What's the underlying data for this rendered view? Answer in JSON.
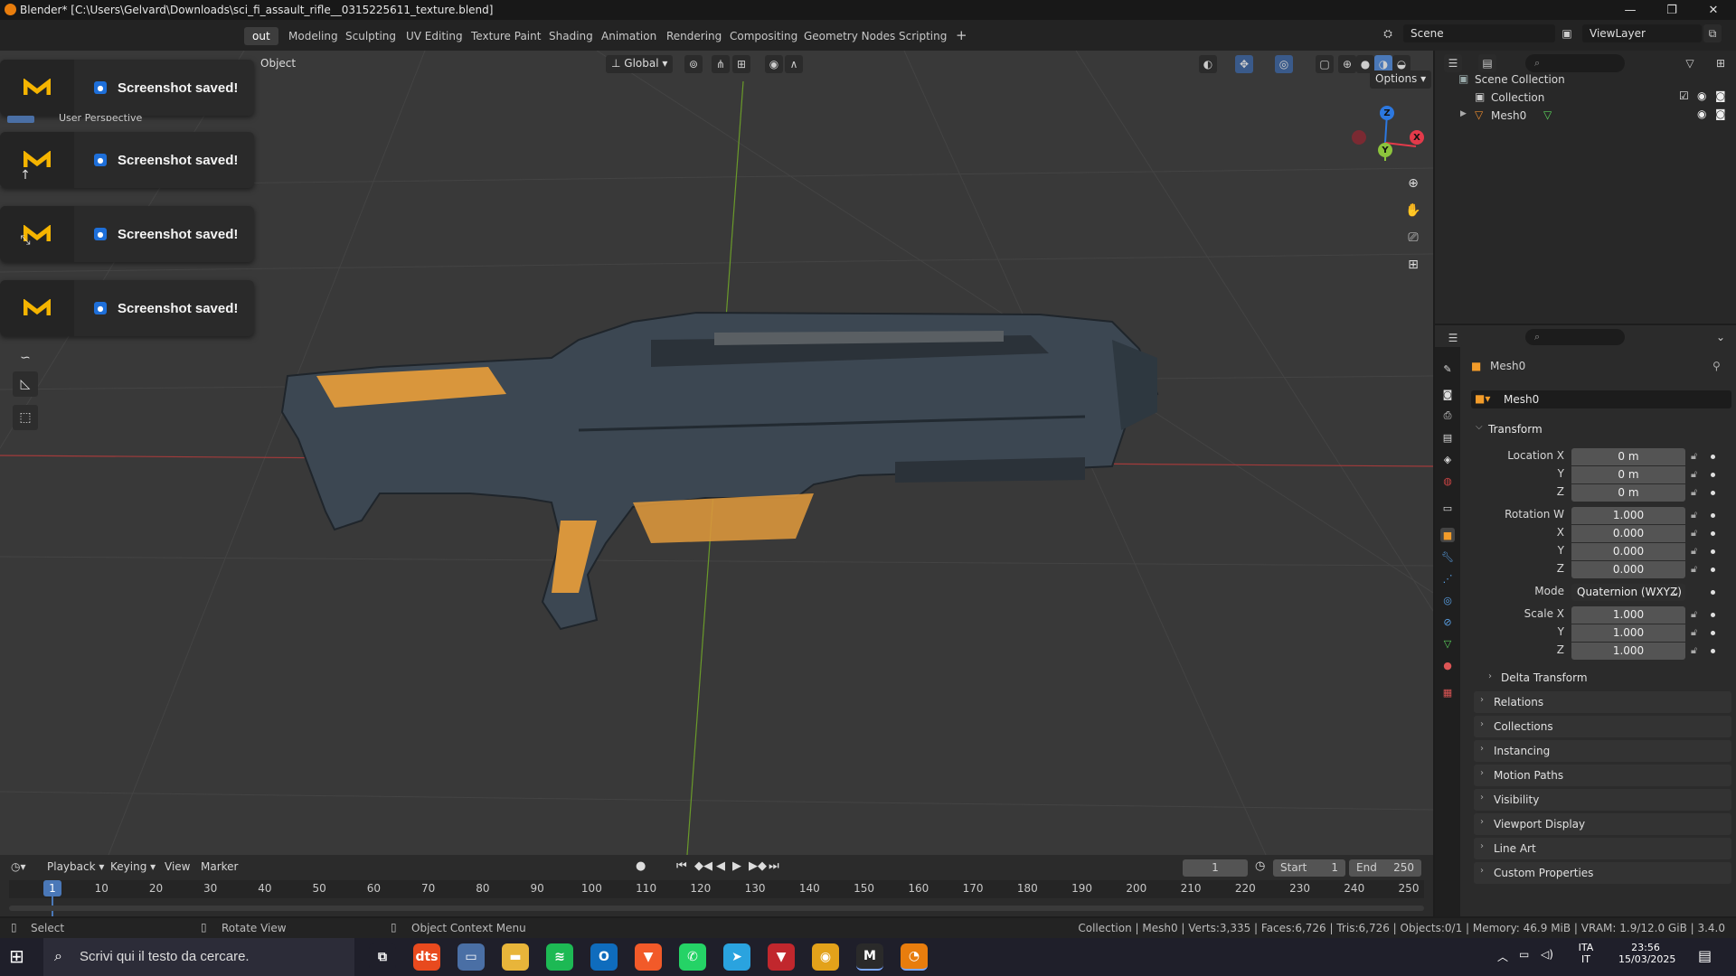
{
  "window": {
    "title": "Blender* [C:\\Users\\Gelvard\\Downloads\\sci_fi_assault_rifle__0315225611_texture.blend]",
    "minimize": "—",
    "maximize": "❐",
    "close": "✕"
  },
  "workspaces": {
    "tabs": [
      {
        "label": "out"
      },
      {
        "label": "Modeling"
      },
      {
        "label": "Sculpting"
      },
      {
        "label": "UV Editing"
      },
      {
        "label": "Texture Paint"
      },
      {
        "label": "Shading"
      },
      {
        "label": "Animation"
      },
      {
        "label": "Rendering"
      },
      {
        "label": "Compositing"
      },
      {
        "label": "Geometry Nodes"
      },
      {
        "label": "Scripting"
      }
    ],
    "add": "+",
    "scene_name": "Scene",
    "view_layer": "ViewLayer"
  },
  "viewport": {
    "mode_menu": "Object",
    "transform_orientation": "Global",
    "options": "Options",
    "toasts": [
      {
        "message": "Screenshot saved!"
      },
      {
        "message": "Screenshot saved!"
      },
      {
        "message": "Screenshot saved!"
      },
      {
        "message": "Screenshot saved!"
      }
    ],
    "partial_label": "User Perspective",
    "gizmo": {
      "z": "Z",
      "x": "X",
      "y": "Y"
    },
    "colors": {
      "x_axis": "#a33b3b",
      "y_axis": "#6a9a2a",
      "gizmo_x": "#e33a4a",
      "gizmo_y": "#8cc43c",
      "gizmo_z": "#2c78e0",
      "rifle_orange": "#d9963c",
      "rifle_body": "#3c4752"
    }
  },
  "outliner": {
    "search_placeholder": "",
    "rows": [
      {
        "label": "Scene Collection"
      },
      {
        "label": "Collection"
      },
      {
        "label": "Mesh0"
      }
    ]
  },
  "properties": {
    "object_name": "Mesh0",
    "data_name": "Mesh0",
    "transform_title": "Transform",
    "location": {
      "label_x": "Location X",
      "label_y": "Y",
      "label_z": "Z",
      "x": "0 m",
      "y": "0 m",
      "z": "0 m"
    },
    "rotation": {
      "label_w": "Rotation W",
      "label_x": "X",
      "label_y": "Y",
      "label_z": "Z",
      "w": "1.000",
      "x": "0.000",
      "y": "0.000",
      "z": "0.000"
    },
    "mode": {
      "label": "Mode",
      "value": "Quaternion (WXYZ)"
    },
    "scale": {
      "label_x": "Scale X",
      "label_y": "Y",
      "label_z": "Z",
      "x": "1.000",
      "y": "1.000",
      "z": "1.000"
    },
    "delta_transform": "Delta Transform",
    "sections": [
      {
        "label": "Relations"
      },
      {
        "label": "Collections"
      },
      {
        "label": "Instancing"
      },
      {
        "label": "Motion Paths"
      },
      {
        "label": "Visibility"
      },
      {
        "label": "Viewport Display"
      },
      {
        "label": "Line Art"
      },
      {
        "label": "Custom Properties"
      }
    ]
  },
  "timeline": {
    "playback": "Playback",
    "keying": "Keying",
    "view": "View",
    "marker": "Marker",
    "current_frame": "1",
    "start_label": "Start",
    "start": "1",
    "end_label": "End",
    "end": "250",
    "ruler": [
      "1",
      "10",
      "20",
      "30",
      "40",
      "50",
      "60",
      "70",
      "80",
      "90",
      "100",
      "110",
      "120",
      "130",
      "140",
      "150",
      "160",
      "170",
      "180",
      "190",
      "200",
      "210",
      "220",
      "230",
      "240",
      "250"
    ]
  },
  "statusbar": {
    "select": "Select",
    "rotate": "Rotate View",
    "context": "Object Context Menu",
    "stats": "Collection | Mesh0 | Verts:3,335 | Faces:6,726 | Tris:6,726 | Objects:0/1 | Memory: 46.9 MiB | VRAM: 1.9/12.0 GiB | 3.4.0"
  },
  "taskbar": {
    "search_placeholder": "Scrivi qui il testo da cercare.",
    "lang_top": "ITA",
    "lang_bottom": "IT",
    "time": "23:56",
    "date": "15/03/2025",
    "apps": [
      {
        "name": "task-view",
        "glyph": "⧉",
        "color": "#1f1f2a"
      },
      {
        "name": "dts",
        "glyph": "dts",
        "color": "#e84a1e"
      },
      {
        "name": "file-store",
        "glyph": "▭",
        "color": "#4a6fa5"
      },
      {
        "name": "file-explorer",
        "glyph": "▬",
        "color": "#e8b53a"
      },
      {
        "name": "spotify",
        "glyph": "≋",
        "color": "#1db954"
      },
      {
        "name": "outlook",
        "glyph": "O",
        "color": "#0f6cbd"
      },
      {
        "name": "brave",
        "glyph": "▼",
        "color": "#f25a29"
      },
      {
        "name": "whatsapp",
        "glyph": "✆",
        "color": "#25d366"
      },
      {
        "name": "telegram",
        "glyph": "➤",
        "color": "#2aa3df"
      },
      {
        "name": "brave-nightly",
        "glyph": "▼",
        "color": "#c1272d"
      },
      {
        "name": "chrome",
        "glyph": "◉",
        "color": "#e3a21a"
      },
      {
        "name": "meshy",
        "glyph": "M",
        "color": "#2a2a2a"
      },
      {
        "name": "blender",
        "glyph": "◔",
        "color": "#e87d0d"
      }
    ]
  }
}
